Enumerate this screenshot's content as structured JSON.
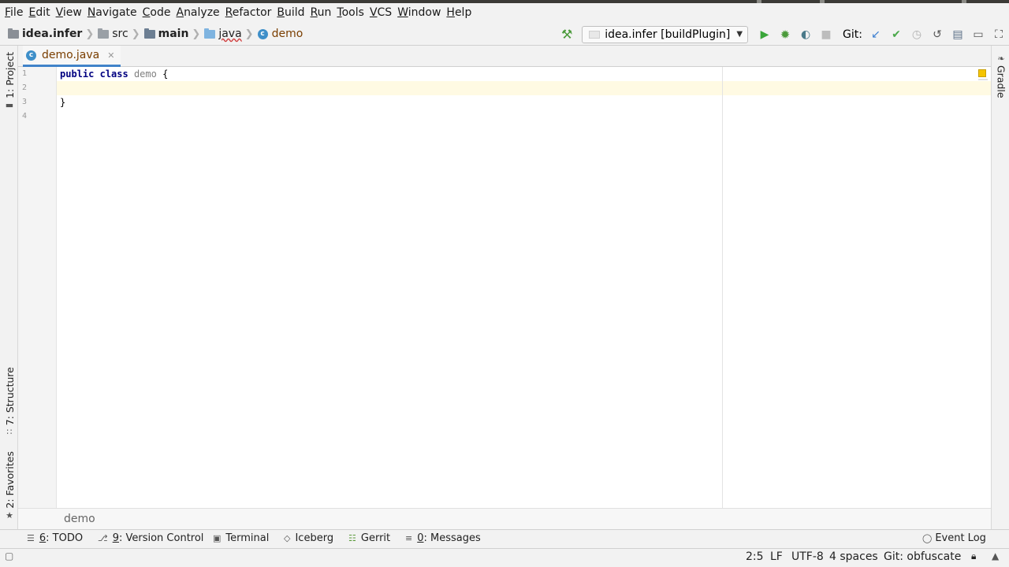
{
  "menu": [
    "File",
    "Edit",
    "View",
    "Navigate",
    "Code",
    "Analyze",
    "Refactor",
    "Build",
    "Run",
    "Tools",
    "VCS",
    "Window",
    "Help"
  ],
  "breadcrumbs": {
    "project": "idea.infer",
    "src": "src",
    "main": "main",
    "java": "java",
    "demo": "demo"
  },
  "toolbar": {
    "run_config": "idea.infer [buildPlugin]",
    "git_label": "Git:"
  },
  "left_tools": {
    "project": "1: Project",
    "structure": "7: Structure",
    "favorites": "2: Favorites"
  },
  "right_tools": {
    "gradle": "Gradle"
  },
  "editor": {
    "tab": "demo.java",
    "line_numbers": [
      "1",
      "2",
      "3",
      "4"
    ],
    "code": {
      "line1_kw1": "public",
      "line1_kw2": "class",
      "line1_name": "demo",
      "line1_brace": "{",
      "line3": "}"
    },
    "breadcrumb": "demo"
  },
  "tool_windows": {
    "todo_num": "6",
    "todo": ": TODO",
    "vc_num": "9",
    "vc": ": Version Control",
    "terminal": "Terminal",
    "iceberg": "Iceberg",
    "gerrit": "Gerrit",
    "messages_num": "0",
    "messages": ": Messages",
    "event_log": "Event Log"
  },
  "status": {
    "position": "2:5",
    "line_sep": "LF",
    "encoding": "UTF-8",
    "indent": "4 spaces",
    "git_branch": "Git: obfuscate"
  },
  "colors": {
    "class_icon": "#3e8fc9",
    "keyword": "#000080",
    "caret_line": "#fffae3",
    "tab_underline": "#4083c9"
  }
}
